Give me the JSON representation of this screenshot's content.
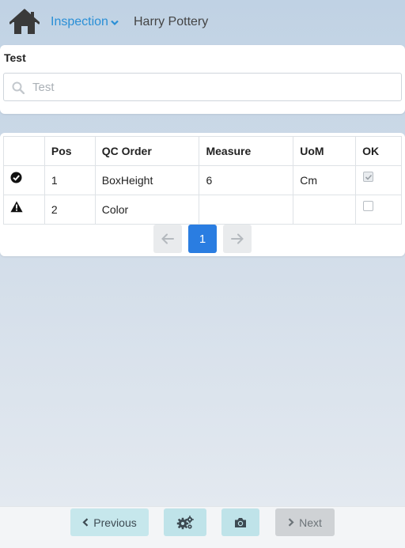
{
  "header": {
    "home_icon": "home-icon",
    "nav_label": "Inspection",
    "context_label": "Harry Pottery",
    "accent_color": "#2a8fd6"
  },
  "filter": {
    "label": "Test",
    "search_placeholder": "Test",
    "search_value": ""
  },
  "table": {
    "headers": [
      "",
      "Pos",
      "QC Order",
      "Measure",
      "UoM",
      "OK"
    ],
    "rows": [
      {
        "status_icon": "check-circle-icon",
        "pos": "1",
        "qc_order": "BoxHeight",
        "measure": "6",
        "uom": "Cm",
        "ok": true
      },
      {
        "status_icon": "warning-icon",
        "pos": "2",
        "qc_order": "Color",
        "measure": "",
        "uom": "",
        "ok": false
      }
    ]
  },
  "pagination": {
    "current_page": "1",
    "prev_icon": "arrow-left-icon",
    "next_icon": "arrow-right-icon",
    "active_color": "#2a7de1"
  },
  "bottom_bar": {
    "previous_label": "Previous",
    "next_label": "Next",
    "settings_icon": "gears-icon",
    "camera_icon": "camera-icon"
  }
}
